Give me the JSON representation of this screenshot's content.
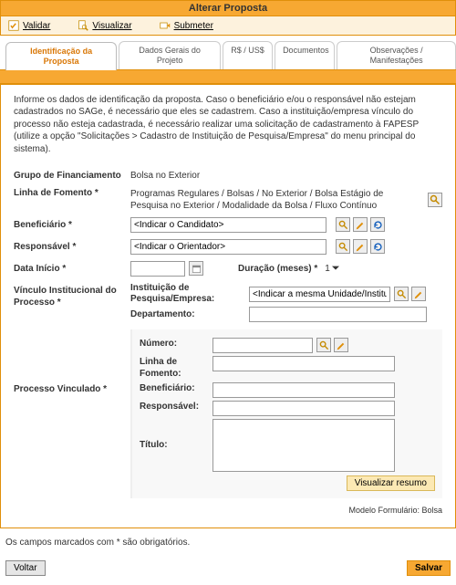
{
  "header": {
    "title": "Alterar Proposta"
  },
  "actions": {
    "validar": "Validar",
    "visualizar": "Visualizar",
    "submeter": "Submeter"
  },
  "tabs": [
    {
      "label": "Identificação da Proposta",
      "active": true
    },
    {
      "label": "Dados Gerais do Projeto"
    },
    {
      "label": "R$ / US$"
    },
    {
      "label": "Documentos"
    },
    {
      "label": "Observações / Manifestações"
    }
  ],
  "intro": "Informe os dados de identificação da proposta. Caso o beneficiário e/ou o responsável não estejam cadastrados no SAGe, é necessário que eles se cadastrem. Caso a instituição/empresa vínculo do processo não esteja cadastrada, é necessário realizar uma solicitação de cadastramento à FAPESP (utilize a opção \"Solicitações > Cadastro de Instituição de Pesquisa/Empresa\" do menu principal do sistema).",
  "form": {
    "grupo_label": "Grupo de Financiamento",
    "grupo_value": "Bolsa no Exterior",
    "linha_label": "Linha de Fomento *",
    "linha_value": "Programas Regulares / Bolsas / No Exterior / Bolsa Estágio de Pesquisa no Exterior / Modalidade da Bolsa / Fluxo Contínuo",
    "beneficiario_label": "Beneficiário *",
    "beneficiario_placeholder": "<Indicar o Candidato>",
    "responsavel_label": "Responsável *",
    "responsavel_placeholder": "<Indicar o Orientador>",
    "data_inicio_label": "Data Início *",
    "duracao_label": "Duração (meses) *",
    "duracao_value": "1",
    "vinculo_label": "Vínculo Institucional do Processo *",
    "instituicao_label": "Instituição de Pesquisa/Empresa:",
    "instituicao_placeholder": "<Indicar a mesma Unidade/Instituição>",
    "departamento_label": "Departamento:",
    "processo_label": "Processo Vinculado *",
    "nested": {
      "numero": "Número:",
      "linha": "Linha de Fomento:",
      "beneficiario": "Beneficiário:",
      "responsavel": "Responsável:",
      "titulo": "Título:"
    },
    "visualizar_resumo": "Visualizar resumo"
  },
  "footer_note": "Modelo Formulário: Bolsa",
  "mandatory_note": "Os campos marcados com * são obrigatórios.",
  "buttons": {
    "voltar": "Voltar",
    "salvar": "Salvar"
  }
}
